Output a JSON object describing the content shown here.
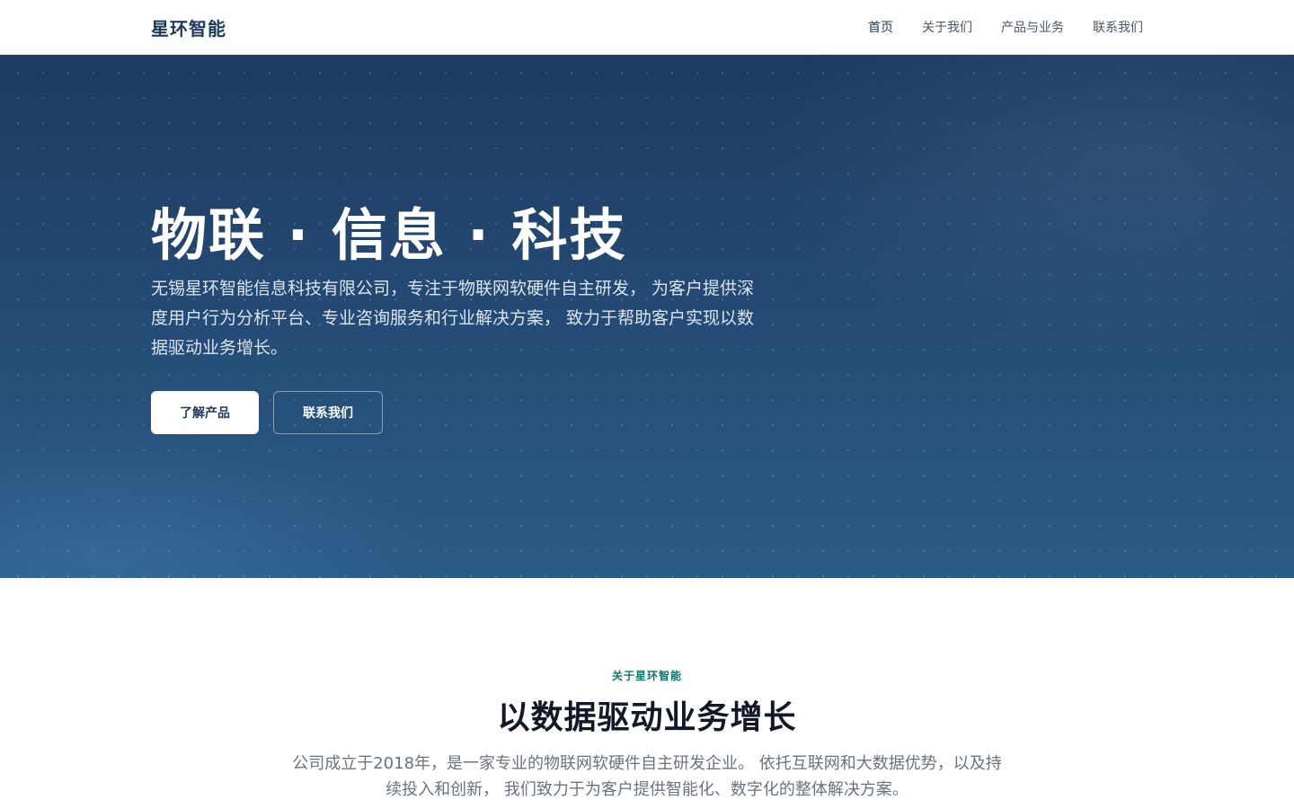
{
  "nav": {
    "brand": "星环智能",
    "links": [
      {
        "label": "首页",
        "active": true
      },
      {
        "label": "关于我们",
        "active": false
      },
      {
        "label": "产品与业务",
        "active": false
      },
      {
        "label": "联系我们",
        "active": false
      }
    ]
  },
  "hero": {
    "title": "物联 · 信息 · 科技",
    "description": "无锡星环智能信息科技有限公司，专注于物联网软硬件自主研发， 为客户提供深度用户行为分析平台、专业咨询服务和行业解决方案， 致力于帮助客户实现以数据驱动业务增长。",
    "primary_button": "了解产品",
    "secondary_button": "联系我们"
  },
  "about": {
    "tag": "关于星环智能",
    "title": "以数据驱动业务增长",
    "description": "公司成立于2018年，是一家专业的物联网软硬件自主研发企业。 依托互联网和大数据优势，以及持续投入和创新， 我们致力于为客户提供智能化、数字化的整体解决方案。"
  },
  "colors": {
    "brand": "#1e3a5f",
    "accent_tag": "#0f766e",
    "hero_bg_top": "#1f3a60",
    "hero_bg_bottom": "#2a5b87"
  }
}
